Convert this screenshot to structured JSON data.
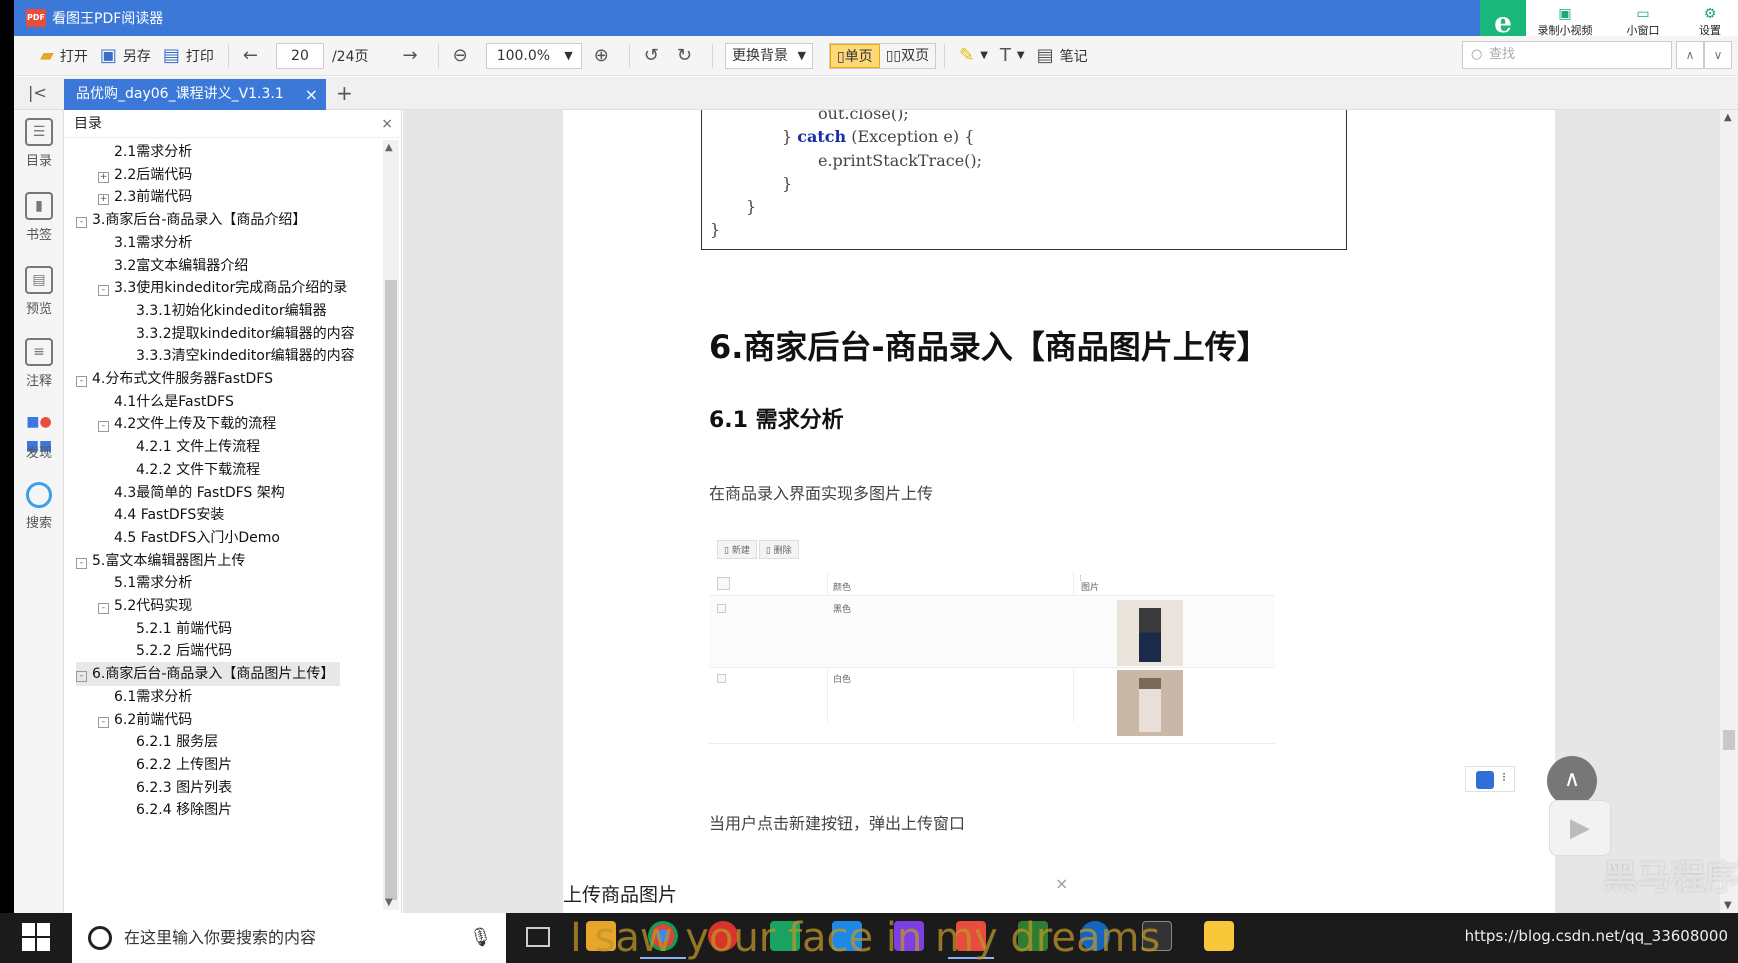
{
  "window": {
    "title": "看图王PDF阅读器",
    "app_icon_text": "PDF"
  },
  "title_right": {
    "record_label": "录制小视频",
    "mini_label": "小窗口",
    "settings_label": "设置"
  },
  "toolbar": {
    "open": "打开",
    "save": "另存",
    "print": "打印",
    "page_current": "20",
    "page_total": "/24页",
    "zoom": "100.0%",
    "background": "更换背景",
    "single_page": "单页",
    "double_page": "双页",
    "notes": "笔记",
    "search_placeholder": "查找"
  },
  "tab": {
    "doc_name": "品优购_day06_课程讲义_V1.3.1"
  },
  "rail": [
    "目录",
    "书签",
    "预览",
    "注释",
    "发现",
    "搜索"
  ],
  "toc": {
    "title": "目录",
    "items": [
      {
        "label": "2.1需求分析",
        "level": 2,
        "exp": ""
      },
      {
        "label": "2.2后端代码",
        "level": 2,
        "exp": "+"
      },
      {
        "label": "2.3前端代码",
        "level": 2,
        "exp": "+"
      },
      {
        "label": "3.商家后台-商品录入【商品介绍】",
        "level": 1,
        "exp": "-"
      },
      {
        "label": "3.1需求分析",
        "level": 2,
        "exp": ""
      },
      {
        "label": "3.2富文本编辑器介绍",
        "level": 2,
        "exp": ""
      },
      {
        "label": "3.3使用kindeditor完成商品介绍的录",
        "level": 2,
        "exp": "-"
      },
      {
        "label": "3.3.1初始化kindeditor编辑器",
        "level": 3,
        "exp": ""
      },
      {
        "label": "3.3.2提取kindeditor编辑器的内容",
        "level": 3,
        "exp": ""
      },
      {
        "label": "3.3.3清空kindeditor编辑器的内容",
        "level": 3,
        "exp": ""
      },
      {
        "label": "4.分布式文件服务器FastDFS",
        "level": 1,
        "exp": "-"
      },
      {
        "label": "4.1什么是FastDFS",
        "level": 2,
        "exp": ""
      },
      {
        "label": "4.2文件上传及下载的流程",
        "level": 2,
        "exp": "-"
      },
      {
        "label": "4.2.1 文件上传流程",
        "level": 3,
        "exp": ""
      },
      {
        "label": "4.2.2 文件下载流程",
        "level": 3,
        "exp": ""
      },
      {
        "label": "4.3最简单的 FastDFS 架构",
        "level": 2,
        "exp": ""
      },
      {
        "label": "4.4 FastDFS安装",
        "level": 2,
        "exp": ""
      },
      {
        "label": "4.5 FastDFS入门小Demo",
        "level": 2,
        "exp": ""
      },
      {
        "label": "5.富文本编辑器图片上传",
        "level": 1,
        "exp": "-"
      },
      {
        "label": "5.1需求分析",
        "level": 2,
        "exp": ""
      },
      {
        "label": "5.2代码实现",
        "level": 2,
        "exp": "-"
      },
      {
        "label": "5.2.1 前端代码",
        "level": 3,
        "exp": ""
      },
      {
        "label": "5.2.2 后端代码",
        "level": 3,
        "exp": ""
      },
      {
        "label": "6.商家后台-商品录入【商品图片上传】",
        "level": 1,
        "exp": "-",
        "selected": true
      },
      {
        "label": "6.1需求分析",
        "level": 2,
        "exp": ""
      },
      {
        "label": "6.2前端代码",
        "level": 2,
        "exp": "-"
      },
      {
        "label": "6.2.1 服务层",
        "level": 3,
        "exp": ""
      },
      {
        "label": "6.2.2 上传图片",
        "level": 3,
        "exp": ""
      },
      {
        "label": "6.2.3 图片列表",
        "level": 3,
        "exp": ""
      },
      {
        "label": "6.2.4 移除图片",
        "level": 3,
        "exp": ""
      }
    ]
  },
  "document": {
    "code": {
      "l1": "out.close();",
      "l2a": "} ",
      "l2kw": "catch",
      "l2b": " (Exception e) {",
      "l3": "e.printStackTrace();",
      "l4": "}",
      "l5": "}",
      "l6": "}"
    },
    "heading1": "6.商家后台-商品录入【商品图片上传】",
    "heading2": "6.1 需求分析",
    "para1": "在商品录入界面实现多图片上传",
    "para2": "当用户点击新建按钮，弹出上传窗口",
    "upload_title": "上传商品图片",
    "upload_close": "×",
    "shot": {
      "btn_new": "新建",
      "btn_delete": "删除",
      "col_color": "颜色",
      "col_image": "图片",
      "rows": [
        {
          "color": "黑色"
        },
        {
          "color": "白色"
        }
      ]
    }
  },
  "watermark": "黑马程序员",
  "taskbar": {
    "search_placeholder": "在这里输入你要搜索的内容",
    "lyrics": "I saw your face in my dreams",
    "url": "https://blog.csdn.net/qq_33608000"
  }
}
